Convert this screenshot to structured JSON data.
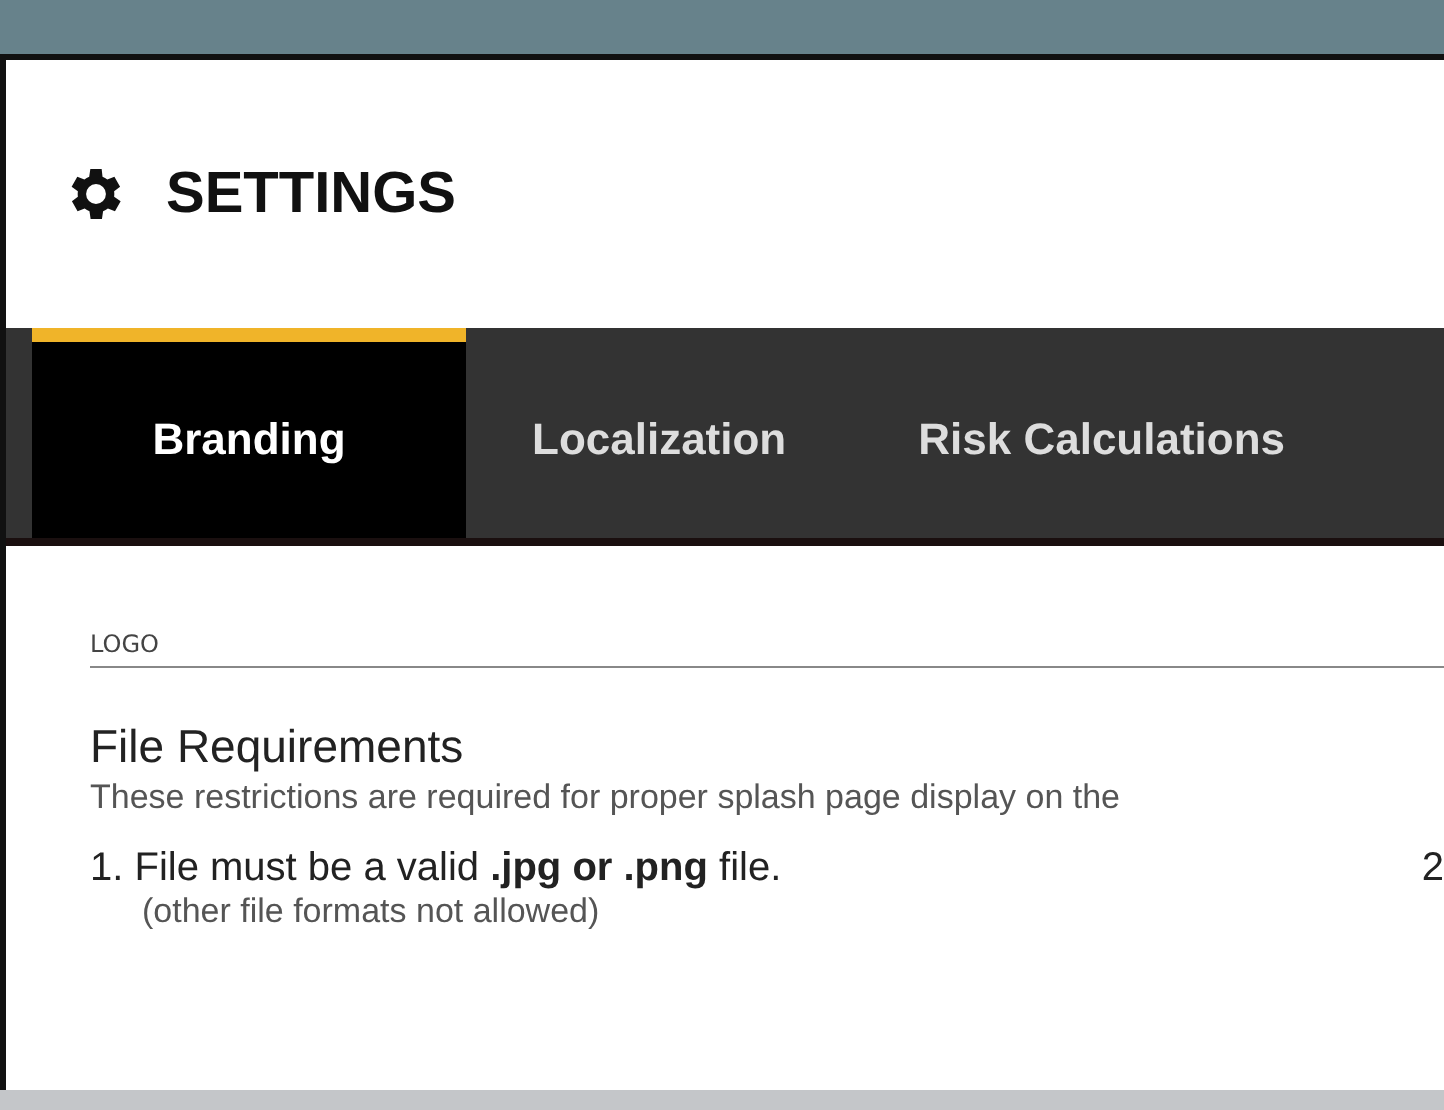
{
  "header": {
    "title": "SETTINGS"
  },
  "tabs": [
    {
      "label": "Branding",
      "selected": true
    },
    {
      "label": "Localization",
      "selected": false
    },
    {
      "label": "Risk Calculations",
      "selected": false
    }
  ],
  "section": {
    "label": "LOGO",
    "heading": "File Requirements",
    "description": "These restrictions are required for proper splash page display on the",
    "requirements": [
      {
        "text": "1. File must be a valid **.jpg or .png** file.",
        "note": "(other file formats not allowed)"
      }
    ],
    "column_2": "2"
  }
}
